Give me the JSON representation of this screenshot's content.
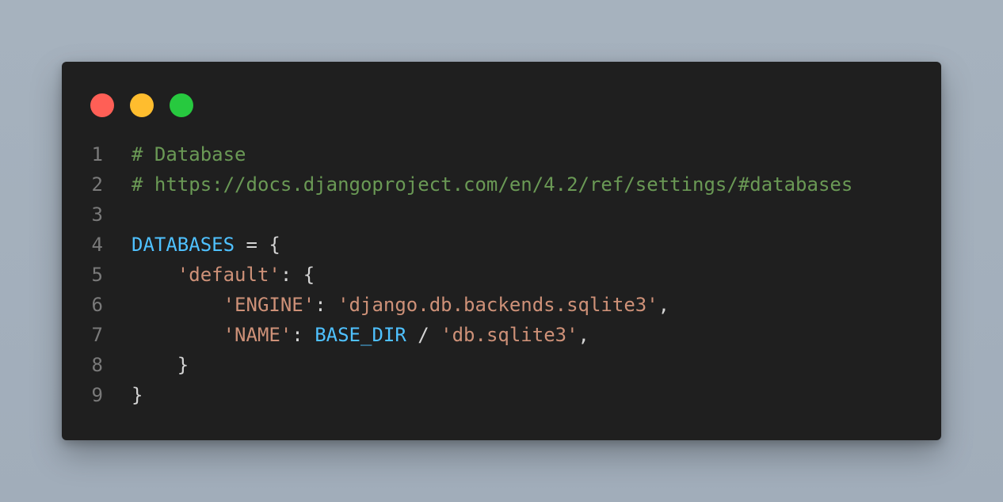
{
  "window": {
    "controls": [
      {
        "name": "close",
        "color": "#ff5f56"
      },
      {
        "name": "minimize",
        "color": "#ffbd2e"
      },
      {
        "name": "maximize",
        "color": "#27c93f"
      }
    ]
  },
  "colors": {
    "background": "#a6b2be",
    "panel": "#1f1f1f",
    "line_number": "#7a7a7a",
    "comment": "#6a9955",
    "identifier": "#4fc1ff",
    "string": "#ce9178",
    "punctuation": "#d4d4d4"
  },
  "code": {
    "lines": [
      {
        "number": "1",
        "tokens": [
          {
            "type": "comment",
            "text": "# Database"
          }
        ]
      },
      {
        "number": "2",
        "tokens": [
          {
            "type": "comment",
            "text": "# https://docs.djangoproject.com/en/4.2/ref/settings/#databases"
          }
        ]
      },
      {
        "number": "3",
        "tokens": []
      },
      {
        "number": "4",
        "tokens": [
          {
            "type": "ident",
            "text": "DATABASES"
          },
          {
            "type": "punct",
            "text": " = {"
          }
        ]
      },
      {
        "number": "5",
        "tokens": [
          {
            "type": "punct",
            "text": "    "
          },
          {
            "type": "string",
            "text": "'default'"
          },
          {
            "type": "punct",
            "text": ": {"
          }
        ]
      },
      {
        "number": "6",
        "tokens": [
          {
            "type": "punct",
            "text": "        "
          },
          {
            "type": "string",
            "text": "'ENGINE'"
          },
          {
            "type": "punct",
            "text": ": "
          },
          {
            "type": "string",
            "text": "'django.db.backends.sqlite3'"
          },
          {
            "type": "punct",
            "text": ","
          }
        ]
      },
      {
        "number": "7",
        "tokens": [
          {
            "type": "punct",
            "text": "        "
          },
          {
            "type": "string",
            "text": "'NAME'"
          },
          {
            "type": "punct",
            "text": ": "
          },
          {
            "type": "ident",
            "text": "BASE_DIR"
          },
          {
            "type": "punct",
            "text": " / "
          },
          {
            "type": "string",
            "text": "'db.sqlite3'"
          },
          {
            "type": "punct",
            "text": ","
          }
        ]
      },
      {
        "number": "8",
        "tokens": [
          {
            "type": "punct",
            "text": "    }"
          }
        ]
      },
      {
        "number": "9",
        "tokens": [
          {
            "type": "punct",
            "text": "}"
          }
        ]
      }
    ]
  }
}
